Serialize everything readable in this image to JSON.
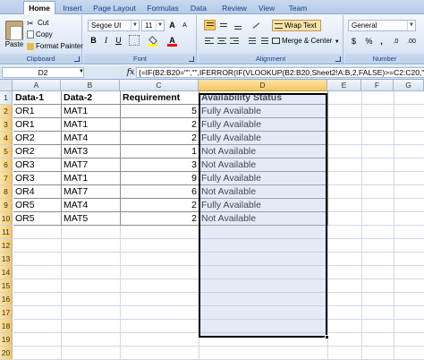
{
  "tabs": [
    "Home",
    "Insert",
    "Page Layout",
    "Formulas",
    "Data",
    "Review",
    "View",
    "Team"
  ],
  "clipboard": {
    "paste_label": "Paste",
    "cut_label": "Cut",
    "copy_label": "Copy",
    "format_painter_label": "Format Painter",
    "group_label": "Clipboard"
  },
  "font": {
    "name": "Segoe UI",
    "size": "11",
    "bold": "B",
    "italic": "I",
    "underline": "U",
    "grow": "A",
    "shrink": "A",
    "font_color_glyph": "A",
    "group_label": "Font"
  },
  "alignment": {
    "wrap_text_label": "Wrap Text",
    "merge_center_label": "Merge & Center",
    "group_label": "Alignment"
  },
  "number": {
    "format": "General",
    "currency": "$",
    "percent": "%",
    "comma": ",",
    "increase_decimal": ".0",
    "decrease_decimal": ".00",
    "group_label": "Number"
  },
  "formula_bar": {
    "name_box": "D2",
    "fx": "fx",
    "formula": "{=IF(B2:B20=\"\",\"\",IFERROR(IF(VLOOKUP(B2:B20,Sheet2!A:B,2,FALSE)>=C2:C20,\"Ful"
  },
  "grid": {
    "columns": [
      "A",
      "B",
      "C",
      "D",
      "E",
      "F",
      "G"
    ],
    "row_numbers": [
      "1",
      "2",
      "3",
      "4",
      "5",
      "6",
      "7",
      "8",
      "9",
      "10",
      "11",
      "12",
      "13",
      "14",
      "15",
      "16",
      "17",
      "18",
      "19",
      "20"
    ],
    "header_row": [
      "Data-1",
      "Data-2",
      "Requirement",
      "Availability Status"
    ],
    "rows": [
      [
        "OR1",
        "MAT1",
        "5",
        "Fully Available"
      ],
      [
        "OR1",
        "MAT1",
        "2",
        "Fully Available"
      ],
      [
        "OR2",
        "MAT4",
        "2",
        "Fully Available"
      ],
      [
        "OR2",
        "MAT3",
        "1",
        "Not Available"
      ],
      [
        "OR3",
        "MAT7",
        "3",
        "Not Available"
      ],
      [
        "OR3",
        "MAT1",
        "9",
        "Fully Available"
      ],
      [
        "OR4",
        "MAT7",
        "6",
        "Not Available"
      ],
      [
        "OR5",
        "MAT4",
        "2",
        "Fully Available"
      ],
      [
        "OR5",
        "MAT5",
        "2",
        "Not Available"
      ]
    ]
  },
  "colors": {
    "ribbon_blue": "#dbe6f5",
    "tab_text": "#15428b",
    "selection_fill": "#b4c4e6",
    "selected_header": "#f7c760",
    "fill_color_swatch": "#ffff00",
    "font_color_swatch": "#ff0000"
  }
}
